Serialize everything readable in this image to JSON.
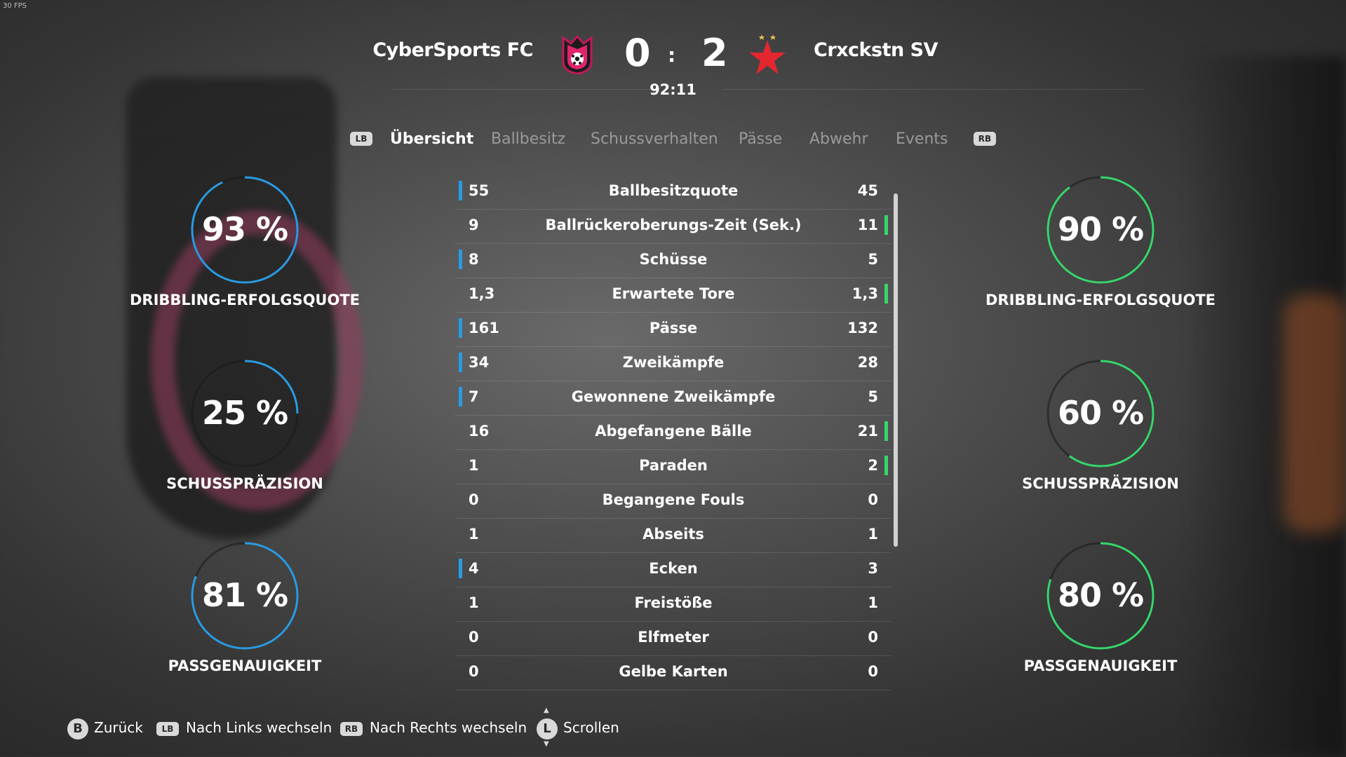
{
  "fps": "30 FPS",
  "header": {
    "home_team": "CyberSports FC",
    "away_team": "Crxckstn SV",
    "home_score": "0",
    "away_score": "2",
    "separator": ":",
    "clock": "92:11"
  },
  "tabs": {
    "lb": "LB",
    "rb": "RB",
    "items": [
      "Übersicht",
      "Ballbesitz",
      "Schussverhalten",
      "Pässe",
      "Abwehr",
      "Events"
    ]
  },
  "stats": [
    {
      "name": "Ballbesitzquote",
      "home": "55",
      "away": "45",
      "leader": "home"
    },
    {
      "name": "Ballrückeroberungs-Zeit (Sek.)",
      "home": "9",
      "away": "11",
      "leader": "away"
    },
    {
      "name": "Schüsse",
      "home": "8",
      "away": "5",
      "leader": "home"
    },
    {
      "name": "Erwartete Tore",
      "home": "1,3",
      "away": "1,3",
      "leader": "away"
    },
    {
      "name": "Pässe",
      "home": "161",
      "away": "132",
      "leader": "home"
    },
    {
      "name": "Zweikämpfe",
      "home": "34",
      "away": "28",
      "leader": "home"
    },
    {
      "name": "Gewonnene Zweikämpfe",
      "home": "7",
      "away": "5",
      "leader": "home"
    },
    {
      "name": "Abgefangene Bälle",
      "home": "16",
      "away": "21",
      "leader": "away"
    },
    {
      "name": "Paraden",
      "home": "1",
      "away": "2",
      "leader": "away"
    },
    {
      "name": "Begangene Fouls",
      "home": "0",
      "away": "0",
      "leader": "none"
    },
    {
      "name": "Abseits",
      "home": "1",
      "away": "1",
      "leader": "none"
    },
    {
      "name": "Ecken",
      "home": "4",
      "away": "3",
      "leader": "home"
    },
    {
      "name": "Freistöße",
      "home": "1",
      "away": "1",
      "leader": "none"
    },
    {
      "name": "Elfmeter",
      "home": "0",
      "away": "0",
      "leader": "none"
    },
    {
      "name": "Gelbe Karten",
      "home": "0",
      "away": "0",
      "leader": "none"
    }
  ],
  "home_rings": [
    {
      "value": "93 %",
      "pct": 93,
      "label": "DRIBBLING-ERFOLGSQUOTE"
    },
    {
      "value": "25 %",
      "pct": 25,
      "label": "SCHUSSPRÄZISION"
    },
    {
      "value": "81 %",
      "pct": 81,
      "label": "PASSGENAUIGKEIT"
    }
  ],
  "away_rings": [
    {
      "value": "90 %",
      "pct": 90,
      "label": "DRIBBLING-ERFOLGSQUOTE"
    },
    {
      "value": "60 %",
      "pct": 60,
      "label": "SCHUSSPRÄZISION"
    },
    {
      "value": "80 %",
      "pct": 80,
      "label": "PASSGENAUIGKEIT"
    }
  ],
  "colors": {
    "home": "#2a9be2",
    "away": "#36d66b"
  },
  "footer": {
    "b_key": "B",
    "back": "Zurück",
    "lb_key": "LB",
    "left": "Nach Links wechseln",
    "rb_key": "RB",
    "right": "Nach Rechts wechseln",
    "l_key": "L",
    "scroll": "Scrollen"
  }
}
